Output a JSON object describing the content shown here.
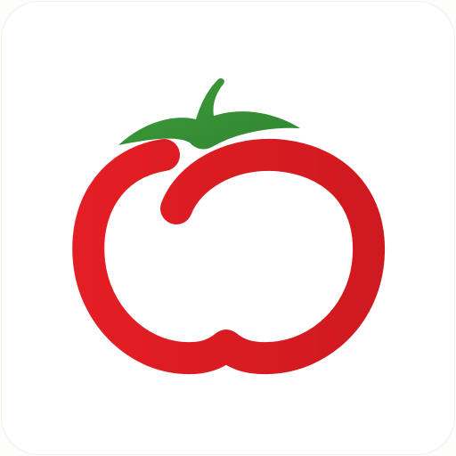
{
  "app_icon": {
    "name": "tomato-app-icon",
    "background_color": "#ffffff",
    "colors": {
      "tomato_red": "#e31e24",
      "tomato_red_dark": "#cf1a20",
      "leaf_green": "#3e9a3a",
      "leaf_green_dark": "#2f8730"
    }
  }
}
